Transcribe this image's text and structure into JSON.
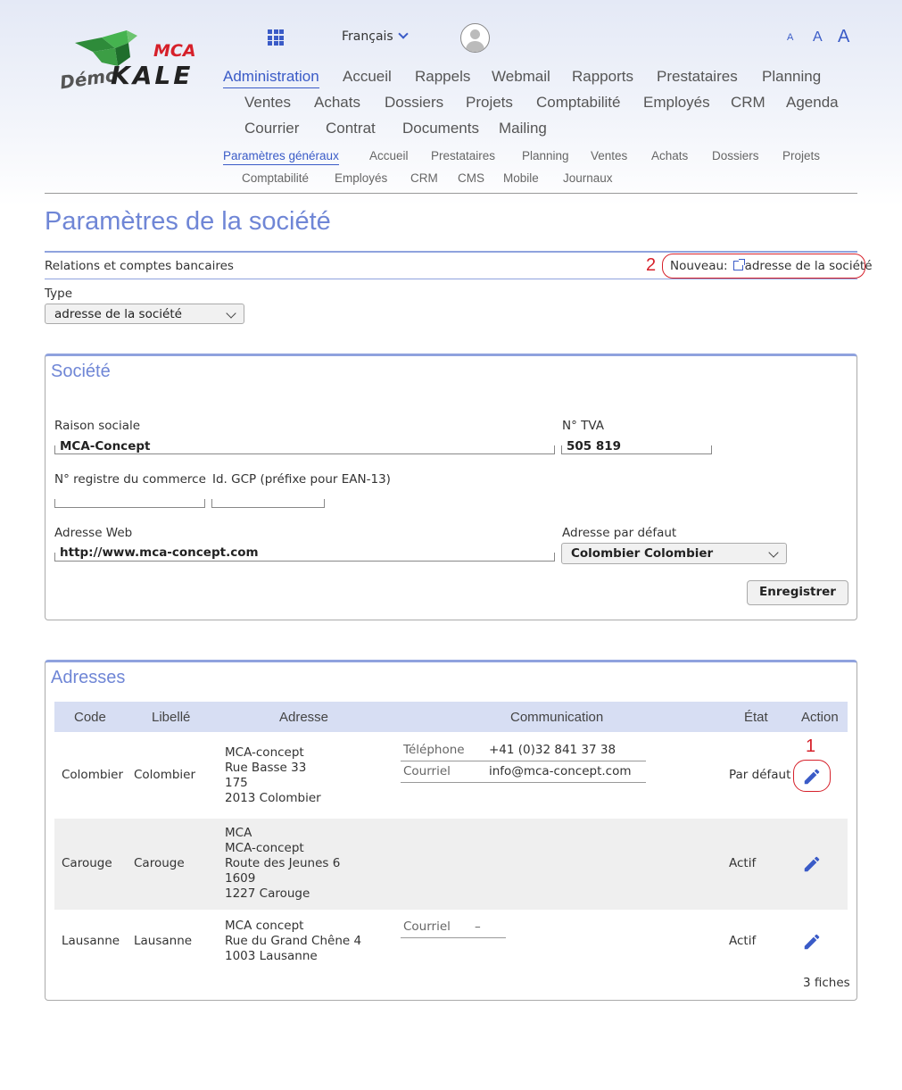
{
  "logo": {
    "demo": "Démo",
    "mca": "MCA",
    "kale": "KALE"
  },
  "topbar": {
    "language": "Français",
    "font_sizes": [
      "A",
      "A",
      "A"
    ]
  },
  "main_nav": [
    "Administration",
    "Accueil",
    "Rappels",
    "Webmail",
    "Rapports",
    "Prestataires",
    "Planning",
    "Ventes",
    "Achats",
    "Dossiers",
    "Projets",
    "Comptabilité",
    "Employés",
    "CRM",
    "Agenda",
    "Courrier",
    "Contrat",
    "Documents",
    "Mailing"
  ],
  "sub_nav": [
    "Paramètres généraux",
    "Accueil",
    "Prestataires",
    "Planning",
    "Ventes",
    "Achats",
    "Dossiers",
    "Projets",
    "Comptabilité",
    "Employés",
    "CRM",
    "CMS",
    "Mobile",
    "Journaux"
  ],
  "page_title": "Paramètres de la société",
  "relations": {
    "label": "Relations et comptes bancaires",
    "new_prefix": "Nouveau:",
    "new_link": "adresse de la société",
    "marker": "2"
  },
  "type_filter": {
    "label": "Type",
    "value": "adresse de la société"
  },
  "societe": {
    "title": "Société",
    "raison_label": "Raison sociale",
    "raison_value": "MCA-Concept",
    "tva_label": "N° TVA",
    "tva_value": "505 819",
    "registre_label": "N° registre du commerce",
    "registre_value": "",
    "gcp_label": "Id. GCP (préfixe pour EAN-13)",
    "gcp_value": "",
    "web_label": "Adresse Web",
    "web_value": "http://www.mca-concept.com",
    "default_addr_label": "Adresse par défaut",
    "default_addr_value": "Colombier   Colombier",
    "save_label": "Enregistrer"
  },
  "adresses": {
    "title": "Adresses",
    "columns": [
      "Code",
      "Libellé",
      "Adresse",
      "Communication",
      "État",
      "Action"
    ],
    "rows": [
      {
        "code": "Colombier",
        "libelle": "Colombier",
        "address": [
          "MCA-concept",
          "Rue Basse 33",
          "175",
          "2013 Colombier"
        ],
        "comm": [
          {
            "label": "Téléphone",
            "value": "+41 (0)32 841 37 38"
          },
          {
            "label": "Courriel",
            "value": "info@mca-concept.com"
          }
        ],
        "state": "Par défaut",
        "marker": "1"
      },
      {
        "code": "Carouge",
        "libelle": "Carouge",
        "address": [
          "MCA",
          "MCA-concept",
          "Route des Jeunes 6",
          "1609",
          "1227 Carouge"
        ],
        "comm": [],
        "state": "Actif"
      },
      {
        "code": "Lausanne",
        "libelle": "Lausanne",
        "address": [
          "MCA concept",
          "Rue du Grand Chêne 4",
          "1003 Lausanne"
        ],
        "comm": [
          {
            "label": "Courriel",
            "value": "–"
          }
        ],
        "state": "Actif"
      }
    ],
    "count": "3 fiches"
  },
  "colors": {
    "accent": "#3a5bc7",
    "title": "#6f86d6",
    "annotation": "#d6202a",
    "table_header": "#d7def3",
    "alt_row": "#efefef"
  }
}
